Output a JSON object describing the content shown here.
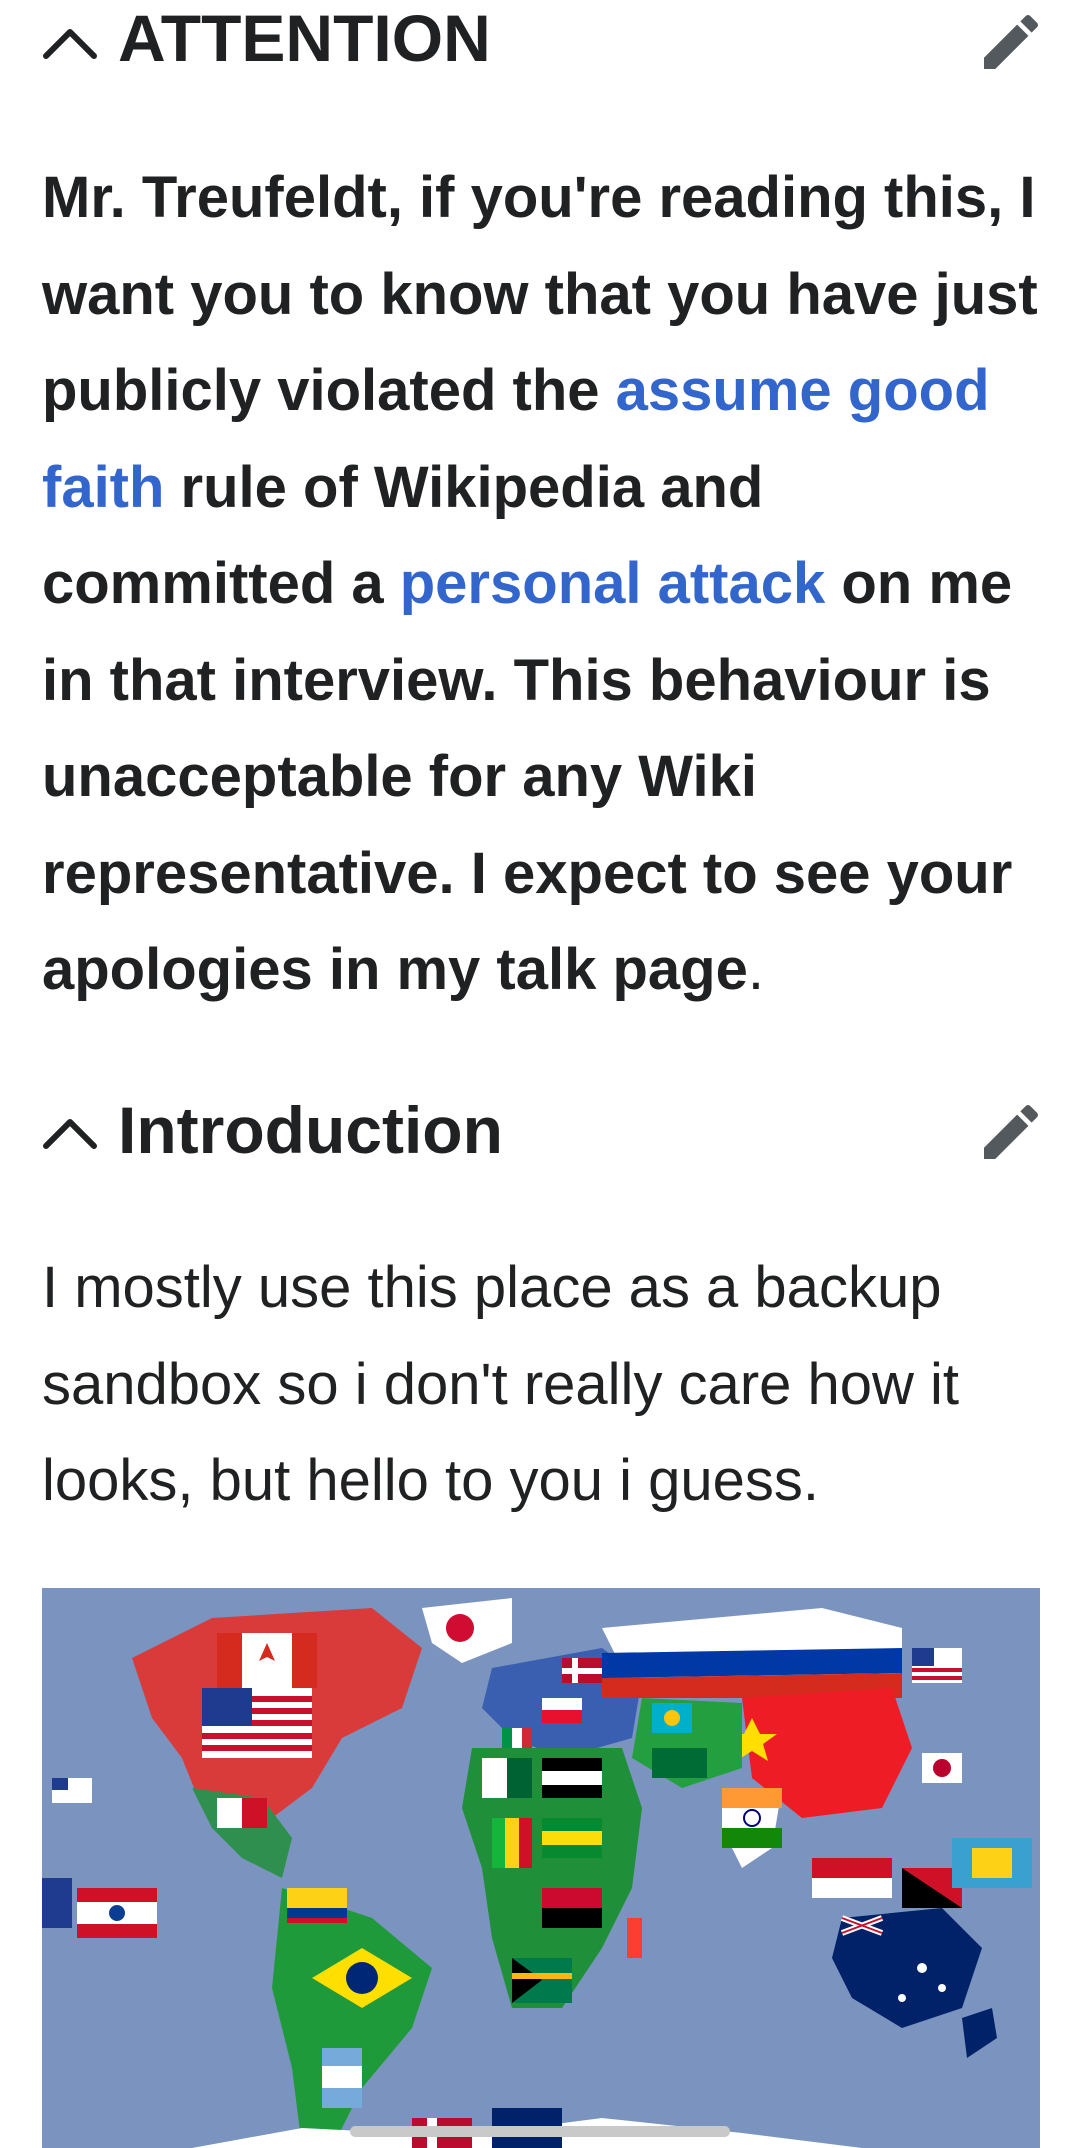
{
  "sections": {
    "attention": {
      "title": "ATTENTION",
      "body": {
        "part1": "Mr. Treufeldt, if you're reading this, I want you to know that you have just publicly violated the ",
        "link1": "assume good faith",
        "part2": " rule of Wikipedia and committed a ",
        "link2": "personal attack",
        "part3": " on me in that interview. This behaviour is unacceptable for any Wiki representative. I expect to see your apologies in my talk page",
        "part4": "."
      }
    },
    "introduction": {
      "title": "Introduction",
      "body": "I mostly use this place as a backup sandbox so i don't really care how it looks, but hello to you i guess."
    }
  },
  "icons": {
    "collapse": "chevron-up-icon",
    "edit": "pencil-icon"
  },
  "colors": {
    "text": "#202122",
    "link": "#3366cc",
    "ocean": "#7b94bf"
  }
}
